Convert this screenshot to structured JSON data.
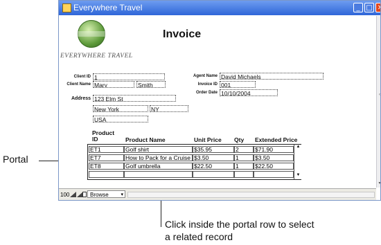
{
  "window": {
    "title": "Everywhere Travel",
    "controls": {
      "minimize": "_",
      "maximize": "□",
      "close": "✕"
    }
  },
  "logo": {
    "text": "EVERYWHERE TRAVEL",
    "icon": "globe-icon"
  },
  "invoice": {
    "title": "Invoice",
    "client_id": {
      "label": "Client ID",
      "value": "1"
    },
    "client_name": {
      "label": "Client Name",
      "first": "Mary",
      "last": "Smith"
    },
    "address": {
      "label": "Address",
      "street": "123 Elm St",
      "city": "New York",
      "state": "NY",
      "country": "USA"
    },
    "agent_name": {
      "label": "Agent Name",
      "value": "David Michaels"
    },
    "invoice_id": {
      "label": "Invoice ID",
      "value": "001"
    },
    "order_date": {
      "label": "Order Date",
      "value": "10/10/2004"
    }
  },
  "portal": {
    "headers": [
      "Product ID",
      "Product Name",
      "Unit Price",
      "Qty",
      "Extended Price"
    ],
    "rows": [
      {
        "id": "ET1",
        "name": "Golf shirt",
        "price": "$35.95",
        "qty": "2",
        "ext": "$71.90"
      },
      {
        "id": "ET7",
        "name": "How to Pack for a Cruise",
        "price": "$3.50",
        "qty": "1",
        "ext": "$3.50"
      },
      {
        "id": "ET8",
        "name": "Golf umbrella",
        "price": "$22.50",
        "qty": "1",
        "ext": "$22.50"
      },
      {
        "id": "",
        "name": "",
        "price": "",
        "qty": "",
        "ext": ""
      }
    ]
  },
  "statusbar": {
    "zoom": "100",
    "mode": "Browse"
  },
  "callouts": {
    "portal": "Portal",
    "row_line1": "Click inside the portal row to select",
    "row_line2": "a related record"
  }
}
